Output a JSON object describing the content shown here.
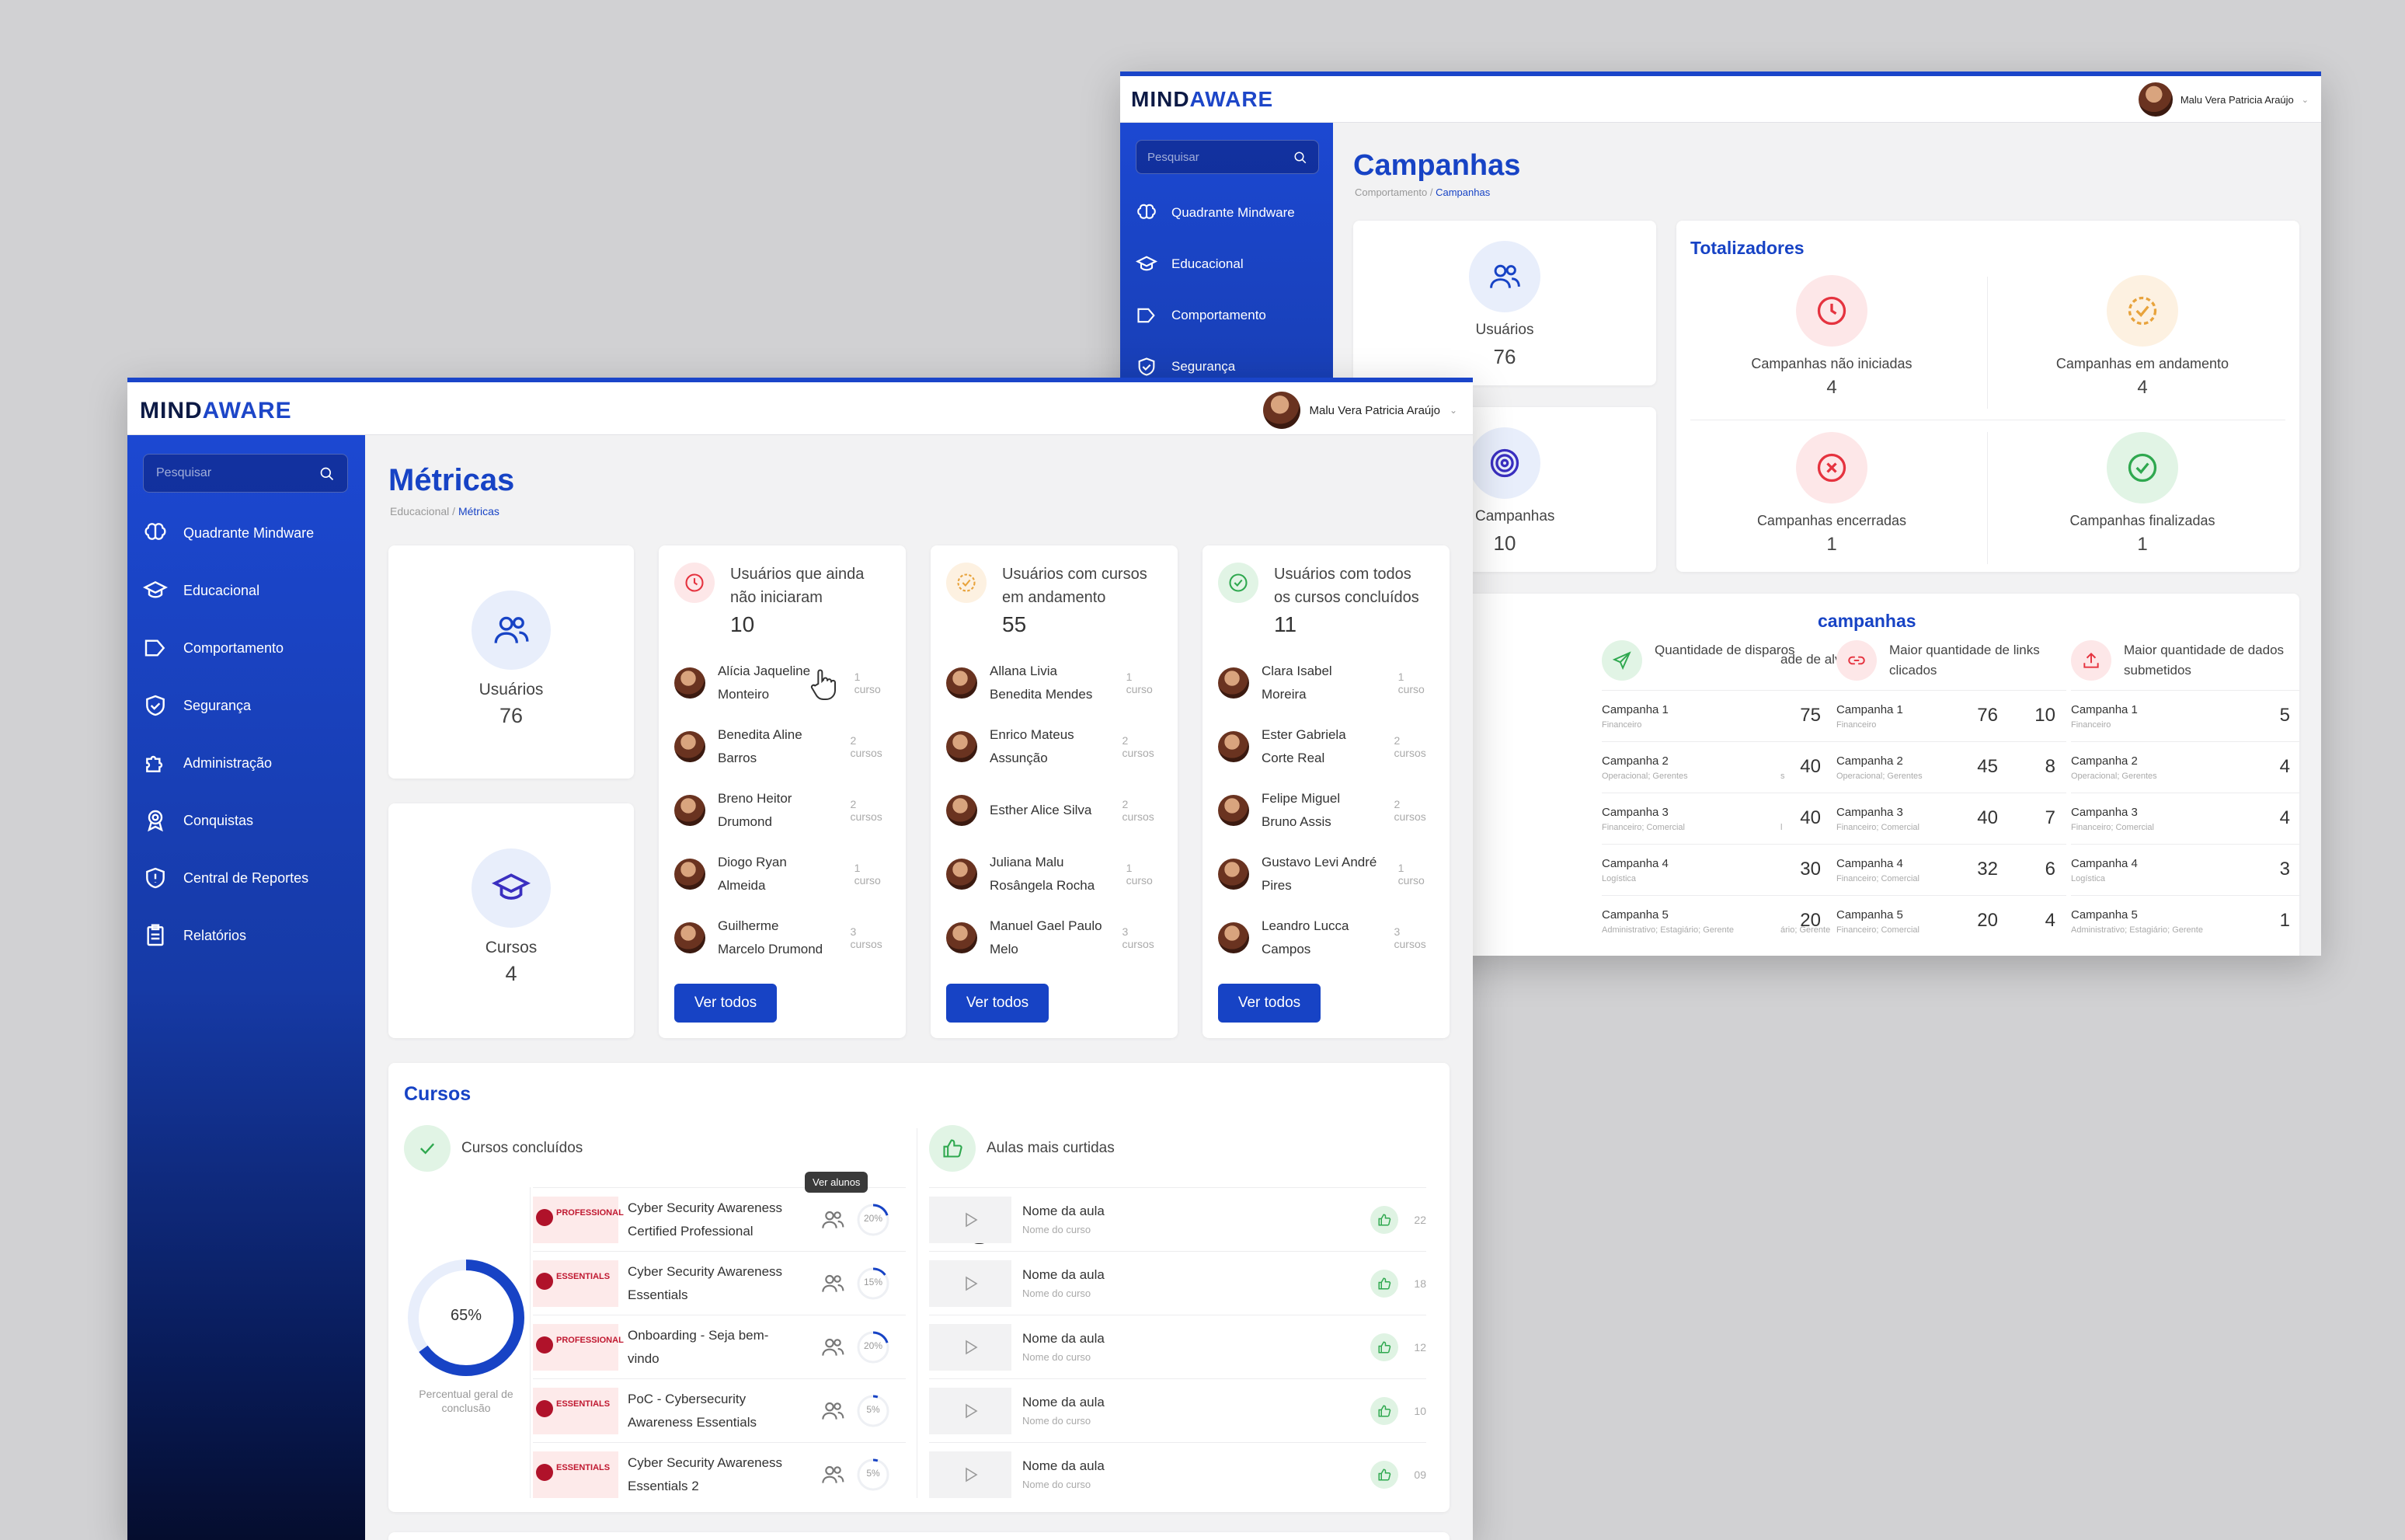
{
  "app": {
    "logo_a": "MIND",
    "logo_b": "AWARE"
  },
  "user": {
    "name": "Malu Vera Patricia Araújo"
  },
  "search": {
    "placeholder": "Pesquisar"
  },
  "nav": {
    "quadrante": "Quadrante Mindware",
    "educacional": "Educacional",
    "comportamento": "Comportamento",
    "seguranca": "Segurança",
    "administracao": "Administração",
    "conquistas": "Conquistas",
    "reportes": "Central de Reportes",
    "relatorios": "Relatórios"
  },
  "campanhas": {
    "title": "Campanhas",
    "breadcrumb": {
      "parent": "Comportamento",
      "sep": "/",
      "current": "Campanhas"
    },
    "usuarios": {
      "label": "Usuários",
      "value": "76"
    },
    "total_campanhas": {
      "label": "de Campanhas",
      "value": "10"
    },
    "totalizadores": {
      "title": "Totalizadores",
      "items": [
        {
          "label": "Campanhas não iniciadas",
          "value": "4"
        },
        {
          "label": "Campanhas em andamento",
          "value": "4"
        },
        {
          "label": "Campanhas encerradas",
          "value": "1"
        },
        {
          "label": "Campanhas finalizadas",
          "value": "1"
        }
      ]
    },
    "top": {
      "title": "campanhas",
      "col0": {
        "label": "ade de alvos",
        "rows": [
          {
            "sub": "",
            "value": "76"
          },
          {
            "sub": "s",
            "value": "45"
          },
          {
            "sub": "l",
            "value": "40"
          },
          {
            "sub": "",
            "value": "32"
          },
          {
            "sub": "ário; Gerente",
            "value": "20"
          }
        ]
      },
      "columns": [
        {
          "label": "Quantidade de disparos",
          "rows": [
            {
              "name": "Campanha 1",
              "sub": "Financeiro",
              "value": "75"
            },
            {
              "name": "Campanha 2",
              "sub": "Operacional; Gerentes",
              "value": "40"
            },
            {
              "name": "Campanha 3",
              "sub": "Financeiro; Comercial",
              "value": "40"
            },
            {
              "name": "Campanha 4",
              "sub": "Logística",
              "value": "30"
            },
            {
              "name": "Campanha 5",
              "sub": "Administrativo; Estagiário; Gerente",
              "value": "20"
            }
          ]
        },
        {
          "label": "Maior quantidade de links clicados",
          "rows": [
            {
              "name": "Campanha 1",
              "sub": "Financeiro",
              "value": "10"
            },
            {
              "name": "Campanha 2",
              "sub": "Operacional; Gerentes",
              "value": "8"
            },
            {
              "name": "Campanha 3",
              "sub": "Financeiro; Comercial",
              "value": "7"
            },
            {
              "name": "Campanha 4",
              "sub": "Financeiro; Comercial",
              "value": "6"
            },
            {
              "name": "Campanha 5",
              "sub": "Financeiro; Comercial",
              "value": "4"
            }
          ]
        },
        {
          "label": "Maior quantidade de dados submetidos",
          "rows": [
            {
              "name": "Campanha 1",
              "sub": "Financeiro",
              "value": "5"
            },
            {
              "name": "Campanha 2",
              "sub": "Operacional; Gerentes",
              "value": "4"
            },
            {
              "name": "Campanha 3",
              "sub": "Financeiro; Comercial",
              "value": "4"
            },
            {
              "name": "Campanha 4",
              "sub": "Logística",
              "value": "3"
            },
            {
              "name": "Campanha 5",
              "sub": "Administrativo; Estagiário; Gerente",
              "value": "1"
            }
          ]
        }
      ]
    }
  },
  "metricas": {
    "title": "Métricas",
    "breadcrumb": {
      "parent": "Educacional",
      "sep": "/",
      "current": "Métricas"
    },
    "usuarios": {
      "label": "Usuários",
      "value": "76"
    },
    "cursos": {
      "label": "Cursos",
      "value": "4"
    },
    "groups": [
      {
        "label_1": "Usuários que ainda",
        "label_2": "não iniciaram",
        "count": "10",
        "users": [
          {
            "n1": "Alícia Jaqueline",
            "n2": "Monteiro",
            "courses": "1 curso"
          },
          {
            "n1": "Benedita Aline",
            "n2": "Barros",
            "courses": "2 cursos"
          },
          {
            "n1": "Breno Heitor",
            "n2": "Drumond",
            "courses": "2 cursos"
          },
          {
            "n1": "Diogo Ryan",
            "n2": "Almeida",
            "courses": "1 curso"
          },
          {
            "n1": "Guilherme",
            "n2": "Marcelo Drumond",
            "courses": "3 cursos"
          }
        ],
        "button": "Ver todos"
      },
      {
        "label_1": "Usuários com cursos",
        "label_2": "em andamento",
        "count": "55",
        "users": [
          {
            "n1": "Allana Livia",
            "n2": "Benedita Mendes",
            "courses": "1 curso"
          },
          {
            "n1": "Enrico Mateus",
            "n2": "Assunção",
            "courses": "2 cursos"
          },
          {
            "n1": "Esther Alice Silva",
            "n2": "",
            "courses": "2 cursos"
          },
          {
            "n1": "Juliana Malu",
            "n2": "Rosângela Rocha",
            "courses": "1 curso"
          },
          {
            "n1": "Manuel Gael Paulo",
            "n2": "Melo",
            "courses": "3 cursos"
          }
        ],
        "button": "Ver todos"
      },
      {
        "label_1": "Usuários com todos",
        "label_2": "os cursos concluídos",
        "count": "11",
        "users": [
          {
            "n1": "Clara Isabel",
            "n2": "Moreira",
            "courses": "1 curso"
          },
          {
            "n1": "Ester Gabriela",
            "n2": "Corte Real",
            "courses": "2 cursos"
          },
          {
            "n1": "Felipe Miguel",
            "n2": "Bruno Assis",
            "courses": "2 cursos"
          },
          {
            "n1": "Gustavo Levi André",
            "n2": "Pires",
            "courses": "1 curso"
          },
          {
            "n1": "Leandro Lucca",
            "n2": "Campos",
            "courses": "3 cursos"
          }
        ],
        "button": "Ver todos"
      }
    ],
    "cursos_section": {
      "title": "Cursos",
      "concluidos_label": "Cursos concluídos",
      "overall_pct": "65%",
      "overall_fraction": 0.65,
      "overall_label_1": "Percentual geral de",
      "overall_label_2": "conclusão",
      "tooltip": "Ver alunos",
      "courses": [
        {
          "n1": "Cyber Security Awareness",
          "n2": "Certified Professional",
          "pct": "20%",
          "fraction": 0.2,
          "badge": "PROFESSIONAL"
        },
        {
          "n1": "Cyber Security Awareness",
          "n2": "Essentials",
          "pct": "15%",
          "fraction": 0.15,
          "badge": "ESSENTIALS"
        },
        {
          "n1": "Onboarding - Seja bem-",
          "n2": "vindo",
          "pct": "20%",
          "fraction": 0.2,
          "badge": "PROFESSIONAL"
        },
        {
          "n1": "PoC - Cybersecurity",
          "n2": "Awareness Essentials",
          "pct": "5%",
          "fraction": 0.05,
          "badge": "ESSENTIALS"
        },
        {
          "n1": "Cyber Security Awareness",
          "n2": "Essentials 2",
          "pct": "5%",
          "fraction": 0.05,
          "badge": "ESSENTIALS"
        }
      ],
      "curtidas_label": "Aulas mais curtidas",
      "lessons": [
        {
          "name": "Nome da aula",
          "course": "Nome do curso",
          "likes": "22"
        },
        {
          "name": "Nome da aula",
          "course": "Nome do curso",
          "likes": "18"
        },
        {
          "name": "Nome da aula",
          "course": "Nome do curso",
          "likes": "12"
        },
        {
          "name": "Nome da aula",
          "course": "Nome do curso",
          "likes": "10"
        },
        {
          "name": "Nome da aula",
          "course": "Nome do curso",
          "likes": "09"
        }
      ]
    }
  },
  "colors": {
    "brand": "#1743c5",
    "success": "#2fa84f",
    "danger": "#e5333f",
    "warning": "#e8a33c"
  }
}
